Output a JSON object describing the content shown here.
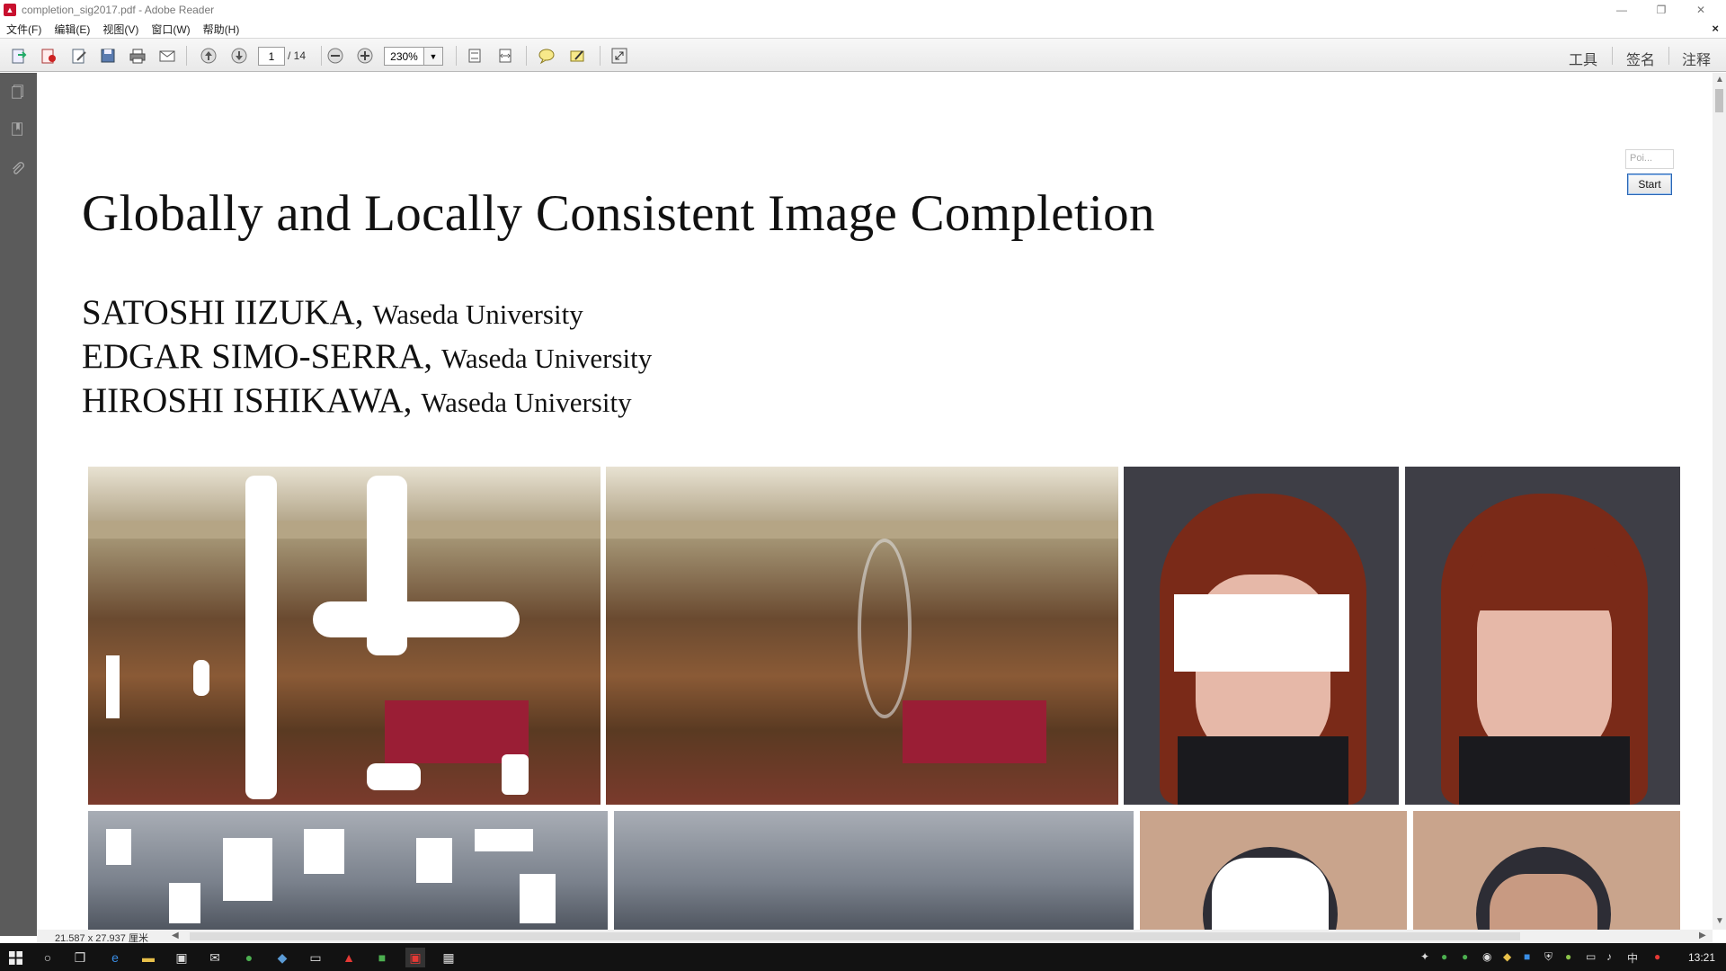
{
  "window": {
    "title": "completion_sig2017.pdf - Adobe Reader",
    "app_icon": "pdf-icon"
  },
  "menu": {
    "items": [
      "文件(F)",
      "编辑(E)",
      "视图(V)",
      "窗口(W)",
      "帮助(H)"
    ],
    "close_doc": "×"
  },
  "toolbar": {
    "page_current": "1",
    "page_total": "/ 14",
    "zoom": "230%",
    "right_tabs": [
      "工具",
      "签名",
      "注释"
    ]
  },
  "document": {
    "title": "Globally and Locally Consistent Image Completion",
    "authors": [
      {
        "name": "SATOSHI IIZUKA,",
        "affiliation": "Waseda University"
      },
      {
        "name": "EDGAR SIMO-SERRA,",
        "affiliation": "Waseda University"
      },
      {
        "name": "HIROSHI ISHIKAWA,",
        "affiliation": "Waseda University"
      }
    ]
  },
  "widget": {
    "field_placeholder": "Poi...",
    "start_label": "Start"
  },
  "status": {
    "page_size": "21.587 x 27.937 厘米"
  },
  "taskbar": {
    "time": "13:21",
    "ime": "中"
  }
}
